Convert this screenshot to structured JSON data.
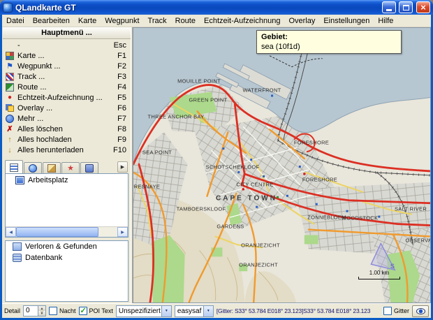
{
  "window": {
    "title": "QLandkarte GT",
    "controls": [
      "minimize",
      "maximize",
      "close"
    ]
  },
  "menubar": {
    "items": [
      "Datei",
      "Bearbeiten",
      "Karte",
      "Wegpunkt",
      "Track",
      "Route",
      "Echtzeit-Aufzeichnung",
      "Overlay",
      "Einstellungen",
      "Hilfe"
    ]
  },
  "sidebar": {
    "header": "Hauptmenü ...",
    "items": [
      {
        "label": "-",
        "shortcut": "Esc",
        "icon": "none",
        "glyph": ""
      },
      {
        "label": "Karte ...",
        "shortcut": "F1",
        "icon": "map-icon",
        "glyph": ""
      },
      {
        "label": "Wegpunkt ...",
        "shortcut": "F2",
        "icon": "flag-icon",
        "glyph": "⚑"
      },
      {
        "label": "Track ...",
        "shortcut": "F3",
        "icon": "track-icon",
        "glyph": ""
      },
      {
        "label": "Route ...",
        "shortcut": "F4",
        "icon": "route-icon",
        "glyph": ""
      },
      {
        "label": "Echtzeit-Aufzeichnung ...",
        "shortcut": "F5",
        "icon": "record-icon",
        "glyph": "●"
      },
      {
        "label": "Overlay ...",
        "shortcut": "F6",
        "icon": "overlay-icon",
        "glyph": ""
      },
      {
        "label": "Mehr ...",
        "shortcut": "F7",
        "icon": "more-icon",
        "glyph": ""
      },
      {
        "label": "Alles löschen",
        "shortcut": "F8",
        "icon": "delete-icon",
        "glyph": "✗"
      },
      {
        "label": "Alles hochladen",
        "shortcut": "F9",
        "icon": "upload-icon",
        "glyph": "↑"
      },
      {
        "label": "Alles herunterladen",
        "shortcut": "F10",
        "icon": "download-icon",
        "glyph": "↓"
      }
    ],
    "tabs": [
      {
        "icon": "list-tab-icon"
      },
      {
        "icon": "globe-tab-icon"
      },
      {
        "icon": "edit-tab-icon"
      },
      {
        "icon": "star-tab-icon",
        "glyph": "★"
      },
      {
        "icon": "database-tab-icon"
      }
    ],
    "workspace_label": "Arbeitsplatz",
    "tree_items": [
      "Verloren & Gefunden",
      "Datenbank"
    ]
  },
  "map": {
    "tooltip": {
      "title": "Gebiet:",
      "value": "sea (10f1d)"
    },
    "labels": [
      "MOUILLE POINT",
      "WATERFRONT",
      "GREEN POINT",
      "THREE ANCHOR BAY",
      "SEA POINT",
      "FORESHORE",
      "SCHOTSCHEKLOOF",
      "CITY CENTRE",
      "FORESHORE",
      "CAPE TOWN",
      "FRESNAYE",
      "TAMBOERSKLOOF",
      "ZONNEBLOEM",
      "WOODSTOCK",
      "GARDENS",
      "ORANJEZICHT",
      "ORANJEZICHT",
      "SALT RIVER",
      "OBSERVATORY"
    ],
    "scale": "1.00 km",
    "compass": "S"
  },
  "statusbar": {
    "detail_label": "Detail",
    "detail_value": "0",
    "nacht_label": "Nacht",
    "poi_text_label": "POI Text",
    "combo_type": "Unspezifiziert",
    "combo_map": "easysaf",
    "coords": "[Gitter: S33° 53.784 E018° 23.123]S33° 53.784 E018° 23.123",
    "gitter_label": "Gitter"
  },
  "colors": {
    "titlebar": "#0A5BC4",
    "close_button": "#D3402C",
    "panel": "#ECE9D8",
    "sea": "#B7C7D1",
    "land": "#E9E6DB",
    "urban": "#D9D9D3",
    "park": "#ACD98B",
    "road_major": "#DC2F23",
    "road_secondary": "#F09A2E",
    "road_minor": "#EDD463",
    "tooltip_bg": "#FFFFDF"
  }
}
